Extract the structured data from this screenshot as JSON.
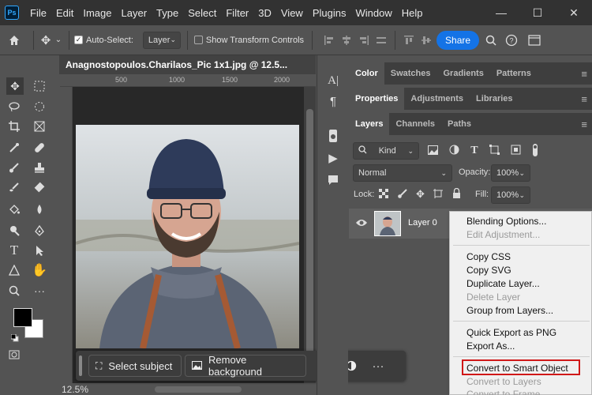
{
  "menu": {
    "logo": "Ps",
    "items": [
      "File",
      "Edit",
      "Image",
      "Layer",
      "Type",
      "Select",
      "Filter",
      "3D",
      "View",
      "Plugins",
      "Window",
      "Help"
    ]
  },
  "window_controls": {
    "minimize": "—",
    "maximize": "☐",
    "close": "✕"
  },
  "options": {
    "auto_select_label": "Auto-Select:",
    "auto_select_checked": true,
    "auto_select_target": "Layer",
    "show_transform_label": "Show Transform Controls",
    "share_label": "Share",
    "more": "···"
  },
  "document": {
    "tab_title": "Anagnostopoulos.Charilaos_Pic 1x1.jpg @ 12.5...",
    "ruler_ticks": [
      "500",
      "1000",
      "1500",
      "2000"
    ],
    "zoom": "12.5%"
  },
  "taskbar": {
    "select_subject": "Select subject",
    "remove_background": "Remove background",
    "more": "···"
  },
  "panels": {
    "row1": [
      "Color",
      "Swatches",
      "Gradients",
      "Patterns"
    ],
    "row2": [
      "Properties",
      "Adjustments",
      "Libraries"
    ],
    "row3": [
      "Layers",
      "Channels",
      "Paths"
    ],
    "kind_label": "Kind",
    "blend_mode": "Normal",
    "opacity_label": "Opacity:",
    "opacity_value": "100%",
    "lock_label": "Lock:",
    "fill_label": "Fill:",
    "fill_value": "100%",
    "layer_name": "Layer 0"
  },
  "context_menu": {
    "items": [
      {
        "label": "Blending Options...",
        "enabled": true
      },
      {
        "label": "Edit Adjustment...",
        "enabled": false
      },
      {
        "label": "Copy CSS",
        "enabled": true
      },
      {
        "label": "Copy SVG",
        "enabled": true
      },
      {
        "label": "Duplicate Layer...",
        "enabled": true
      },
      {
        "label": "Delete Layer",
        "enabled": false
      },
      {
        "label": "Group from Layers...",
        "enabled": true
      },
      {
        "label": "Quick Export as PNG",
        "enabled": true
      },
      {
        "label": "Export As...",
        "enabled": true
      },
      {
        "label": "Convert to Smart Object",
        "enabled": true,
        "highlighted": true
      },
      {
        "label": "Convert to Layers",
        "enabled": false
      },
      {
        "label": "Convert to Frame",
        "enabled": false
      }
    ]
  },
  "colors": {
    "highlight_box": "#d01818",
    "share_button": "#1473e6",
    "foreground": "#000000",
    "background": "#ffffff"
  }
}
